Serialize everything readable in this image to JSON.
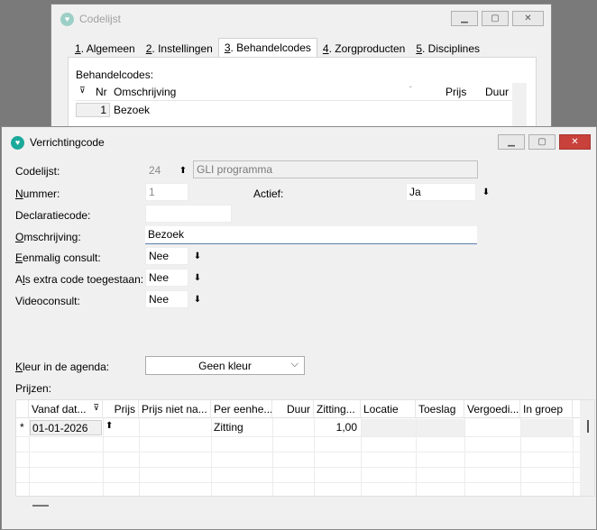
{
  "back_window": {
    "title": "Codelijst",
    "tabs": [
      {
        "key": "1",
        "rest": ". Algemeen"
      },
      {
        "key": "2",
        "rest": ". Instellingen"
      },
      {
        "key": "3",
        "rest": ". Behandelcodes"
      },
      {
        "key": "4",
        "rest": ". Zorgproducten"
      },
      {
        "key": "5",
        "rest": ". Disciplines"
      }
    ],
    "active_tab": "3. Behandelcodes",
    "list_label": "Behandelcodes:",
    "columns": {
      "nr": "Nr",
      "omschrijving": "Omschrijving",
      "prijs": "Prijs",
      "duur": "Duur"
    },
    "rows": [
      {
        "nr": "1",
        "omschrijving": "Bezoek"
      }
    ]
  },
  "front_window": {
    "title": "Verrichtingcode",
    "fields": {
      "codelijst": {
        "label": "Codelijst:",
        "value": "24",
        "name": "GLI programma"
      },
      "nummer": {
        "label": "Nummer:",
        "value": "1"
      },
      "actief": {
        "label": "Actief:",
        "value": "Ja"
      },
      "declaratiecode": {
        "label": "Declaratiecode:",
        "value": ""
      },
      "omschrijving": {
        "label": "Omschrijving:",
        "value": "Bezoek"
      },
      "eenmalig_consult": {
        "label": "Eenmalig consult:",
        "value": "Nee"
      },
      "als_extra_code": {
        "label": "Als extra code toegestaan:",
        "value": "Nee"
      },
      "videoconsult": {
        "label": "Videoconsult:",
        "value": "Nee"
      },
      "kleur": {
        "label": "Kleur in de agenda:",
        "value": "Geen kleur"
      },
      "prijzen": {
        "label": "Prijzen:"
      }
    },
    "prices_grid": {
      "columns": [
        "Vanaf dat...",
        "Prijs",
        "Prijs niet na...",
        "Per eenhe...",
        "Duur",
        "Zitting...",
        "Locatie",
        "Toeslag",
        "Vergoedi...",
        "In groep"
      ],
      "new_row_marker": "*",
      "rows": [
        {
          "vanaf": "01-01-2026",
          "per_eenheid": "Zitting",
          "zitting": "1,00"
        }
      ]
    }
  }
}
